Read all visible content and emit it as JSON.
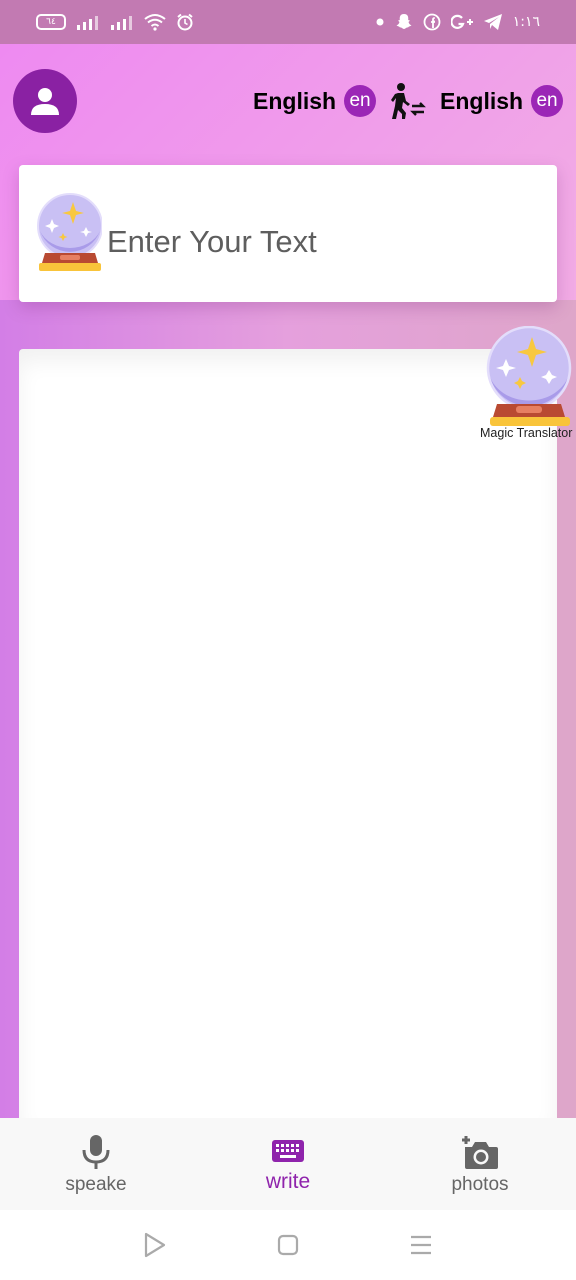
{
  "status_bar": {
    "battery": "٦٤",
    "time": "١:١٦"
  },
  "header": {
    "source_language": {
      "name": "English",
      "code": "en"
    },
    "target_language": {
      "name": "English",
      "code": "en"
    }
  },
  "input": {
    "placeholder": "Enter Your Text",
    "value": ""
  },
  "floating": {
    "label": "Magic Translator"
  },
  "bottom_nav": {
    "items": [
      {
        "label": "speake",
        "icon": "microphone-icon",
        "active": false
      },
      {
        "label": "write",
        "icon": "keyboard-icon",
        "active": true
      },
      {
        "label": "photos",
        "icon": "add-camera-icon",
        "active": false
      }
    ]
  },
  "colors": {
    "accent": "#9b26b6",
    "avatar": "#8a21a3",
    "active_nav": "#8f24ac"
  }
}
